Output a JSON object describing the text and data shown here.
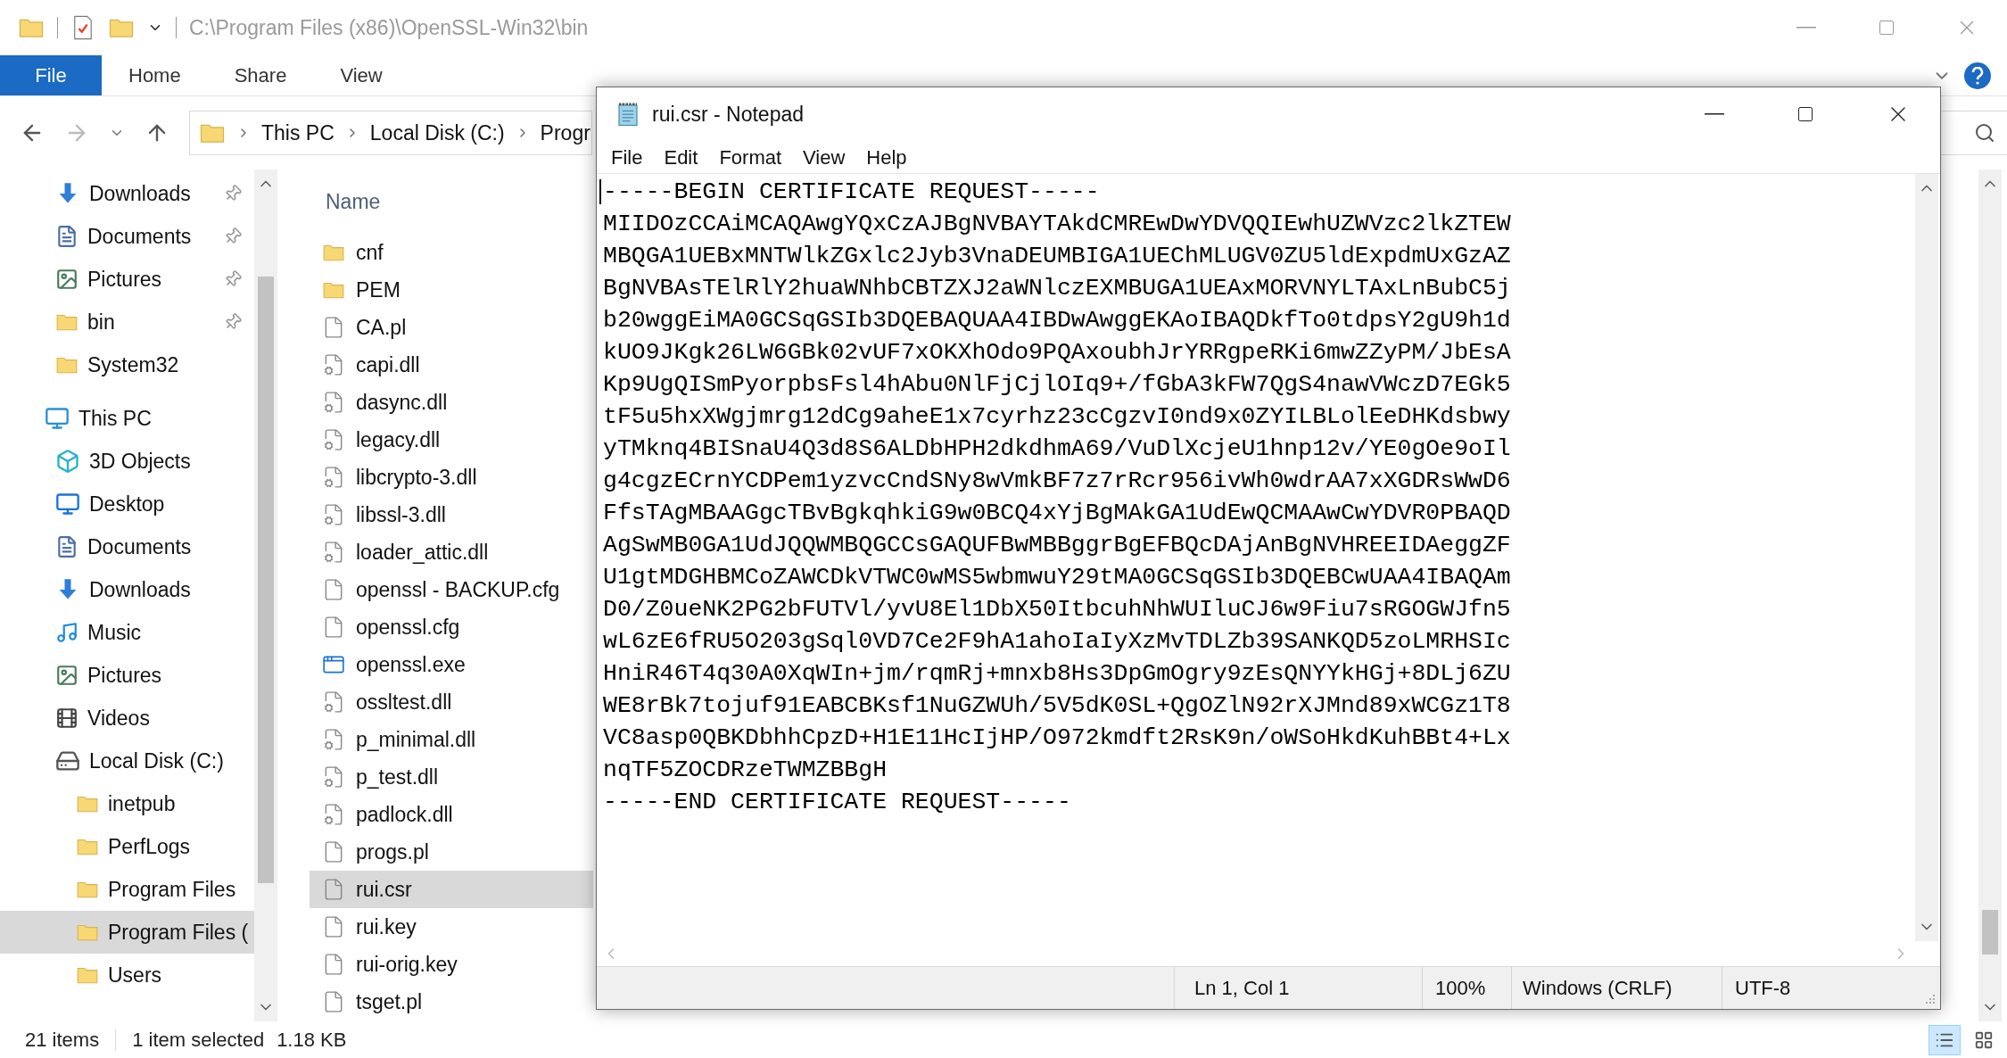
{
  "explorer": {
    "title_path": "C:\\Program Files (x86)\\OpenSSL-Win32\\bin",
    "ribbon_tabs": [
      {
        "label": "File",
        "selected": true
      },
      {
        "label": "Home",
        "selected": false
      },
      {
        "label": "Share",
        "selected": false
      },
      {
        "label": "View",
        "selected": false
      }
    ],
    "address_segments": [
      "This PC",
      "Local Disk (C:)",
      "Progr"
    ],
    "nav": {
      "quick_access": [
        {
          "label": "Downloads",
          "kind": "download",
          "pinned": true,
          "selected": false
        },
        {
          "label": "Documents",
          "kind": "document",
          "pinned": true,
          "selected": false
        },
        {
          "label": "Pictures",
          "kind": "picture",
          "pinned": true,
          "selected": false
        },
        {
          "label": "bin",
          "kind": "folder",
          "pinned": true,
          "selected": false
        },
        {
          "label": "System32",
          "kind": "folder",
          "pinned": false,
          "selected": false
        }
      ],
      "tree": [
        {
          "label": "This PC",
          "kind": "pc",
          "selected": false,
          "children": [
            {
              "label": "3D Objects",
              "kind": "cube",
              "selected": false
            },
            {
              "label": "Desktop",
              "kind": "desktop",
              "selected": false
            },
            {
              "label": "Documents",
              "kind": "document",
              "selected": false
            },
            {
              "label": "Downloads",
              "kind": "download",
              "selected": false
            },
            {
              "label": "Music",
              "kind": "music",
              "selected": false
            },
            {
              "label": "Pictures",
              "kind": "picture",
              "selected": false
            },
            {
              "label": "Videos",
              "kind": "video",
              "selected": false
            },
            {
              "label": "Local Disk (C:)",
              "kind": "disk",
              "selected": false,
              "children": [
                {
                  "label": "inetpub",
                  "kind": "folder",
                  "selected": false
                },
                {
                  "label": "PerfLogs",
                  "kind": "folder",
                  "selected": false
                },
                {
                  "label": "Program Files",
                  "kind": "folder",
                  "selected": false
                },
                {
                  "label": "Program Files (",
                  "kind": "folder",
                  "selected": true
                },
                {
                  "label": "Users",
                  "kind": "folder",
                  "selected": false
                }
              ]
            }
          ]
        }
      ]
    },
    "column_header": "Name",
    "files": [
      {
        "name": "cnf",
        "kind": "folder",
        "selected": false
      },
      {
        "name": "PEM",
        "kind": "folder",
        "selected": false
      },
      {
        "name": "CA.pl",
        "kind": "file",
        "selected": false
      },
      {
        "name": "capi.dll",
        "kind": "dll",
        "selected": false
      },
      {
        "name": "dasync.dll",
        "kind": "dll",
        "selected": false
      },
      {
        "name": "legacy.dll",
        "kind": "dll",
        "selected": false
      },
      {
        "name": "libcrypto-3.dll",
        "kind": "dll",
        "selected": false
      },
      {
        "name": "libssl-3.dll",
        "kind": "dll",
        "selected": false
      },
      {
        "name": "loader_attic.dll",
        "kind": "dll",
        "selected": false
      },
      {
        "name": "openssl - BACKUP.cfg",
        "kind": "file",
        "selected": false
      },
      {
        "name": "openssl.cfg",
        "kind": "file",
        "selected": false
      },
      {
        "name": "openssl.exe",
        "kind": "exe",
        "selected": false
      },
      {
        "name": "ossltest.dll",
        "kind": "dll",
        "selected": false
      },
      {
        "name": "p_minimal.dll",
        "kind": "dll",
        "selected": false
      },
      {
        "name": "p_test.dll",
        "kind": "dll",
        "selected": false
      },
      {
        "name": "padlock.dll",
        "kind": "dll",
        "selected": false
      },
      {
        "name": "progs.pl",
        "kind": "file",
        "selected": false
      },
      {
        "name": "rui.csr",
        "kind": "file",
        "selected": true
      },
      {
        "name": "rui.key",
        "kind": "file",
        "selected": false
      },
      {
        "name": "rui-orig.key",
        "kind": "file",
        "selected": false
      },
      {
        "name": "tsget.pl",
        "kind": "file",
        "selected": false
      }
    ],
    "status": {
      "item_count": "21 items",
      "selection": "1 item selected",
      "size": "1.18 KB"
    },
    "view_buttons": [
      {
        "kind": "details",
        "selected": true
      },
      {
        "kind": "large_icons",
        "selected": false
      }
    ]
  },
  "notepad": {
    "title": "rui.csr - Notepad",
    "menu": [
      "File",
      "Edit",
      "Format",
      "View",
      "Help"
    ],
    "lines": [
      "-----BEGIN CERTIFICATE REQUEST-----",
      "MIIDOzCCAiMCAQAwgYQxCzAJBgNVBAYTAkdCMREwDwYDVQQIEwhUZWVzc2lkZTEW",
      "MBQGA1UEBxMNTWlkZGxlc2Jyb3VnaDEUMBIGA1UEChMLUGV0ZU5ldExpdmUxGzAZ",
      "BgNVBAsTElRlY2huaWNhbCBTZXJ2aWNlczEXMBUGA1UEAxMORVNYLTAxLnBubC5j",
      "b20wggEiMA0GCSqGSIb3DQEBAQUAA4IBDwAwggEKAoIBAQDkfTo0tdpsY2gU9h1d",
      "kUO9JKgk26LW6GBk02vUF7xOKXhOdo9PQAxoubhJrYRRgpeRKi6mwZZyPM/JbEsA",
      "Kp9UgQISmPyorpbsFsl4hAbu0NlFjCjlOIq9+/fGbA3kFW7QgS4nawVWczD7EGk5",
      "tF5u5hxXWgjmrg12dCg9aheE1x7cyrhz23cCgzvI0nd9x0ZYILBLolEeDHKdsbwy",
      "yTMknq4BISnaU4Q3d8S6ALDbHPH2dkdhmA69/VuDlXcjeU1hnp12v/YE0gOe9oIl",
      "g4cgzECrnYCDPem1yzvcCndSNy8wVmkBF7z7rRcr956ivWh0wdrAA7xXGDRsWwD6",
      "FfsTAgMBAAGgcTBvBgkqhkiG9w0BCQ4xYjBgMAkGA1UdEwQCMAAwCwYDVR0PBAQD",
      "AgSwMB0GA1UdJQQWMBQGCCsGAQUFBwMBBggrBgEFBQcDAjAnBgNVHREEIDAeggZF",
      "U1gtMDGHBMCoZAWCDkVTWC0wMS5wbmwuY29tMA0GCSqGSIb3DQEBCwUAA4IBAQAm",
      "D0/Z0ueNK2PG2bFUTVl/yvU8El1DbX50ItbcuhNhWUIluCJ6w9Fiu7sRGOGWJfn5",
      "wL6zE6fRU5O203gSql0VD7Ce2F9hA1ahoIaIyXzMvTDLZb39SANKQD5zoLMRHSIc",
      "HniR46T4q30A0XqWIn+jm/rqmRj+mnxb8Hs3DpGmOgry9zEsQNYYkHGj+8DLj6ZU",
      "WE8rBk7tojuf91EABCBKsf1NuGZWUh/5V5dK0SL+QgOZlN92rXJMnd89xWCGz1T8",
      "VC8asp0QBKDbhhCpzD+H1E11HcIjHP/O972kmdft2RsK9n/oWSoHkdKuhBBt4+Lx",
      "nqTF5ZOCDRzeTWMZBBgH",
      "-----END CERTIFICATE REQUEST-----"
    ],
    "status": {
      "position": "Ln 1, Col 1",
      "zoom": "100%",
      "line_endings": "Windows (CRLF)",
      "encoding": "UTF-8"
    }
  }
}
